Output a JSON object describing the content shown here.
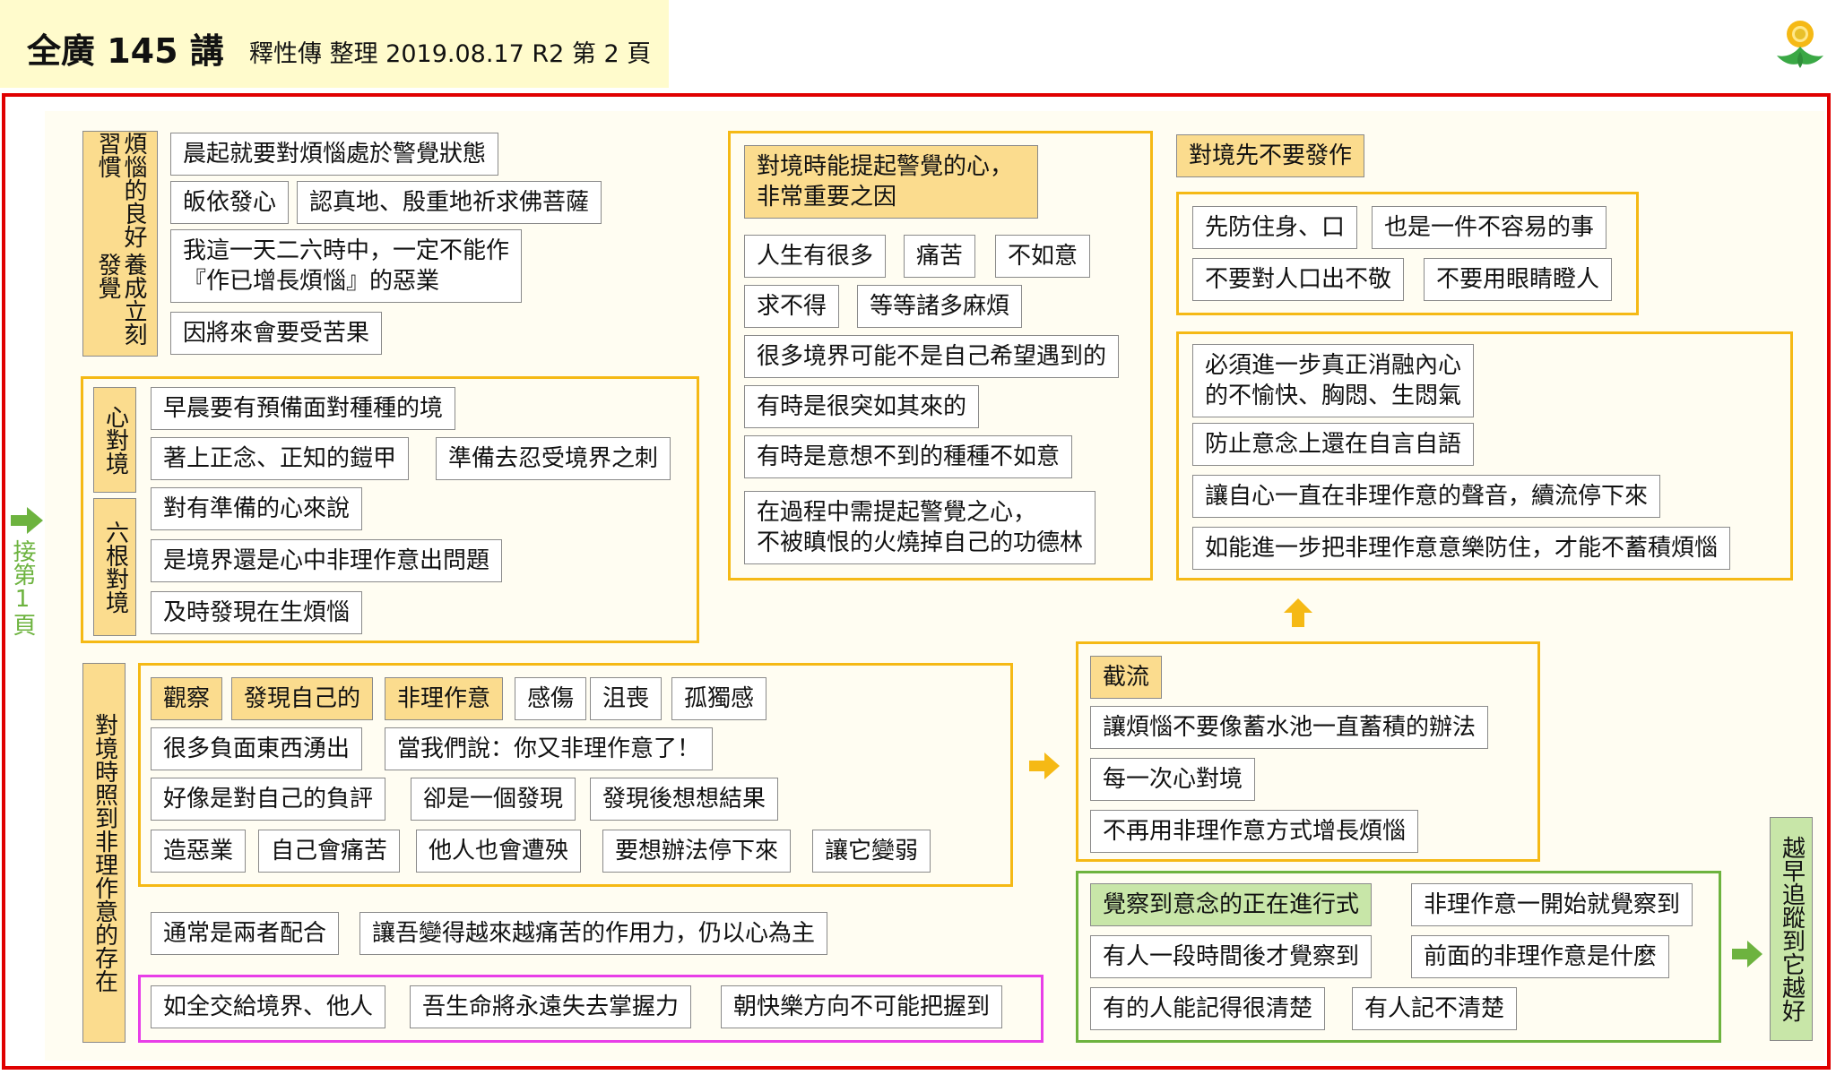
{
  "header": {
    "title": "全廣 145 講",
    "subtitle": "釋性傳 整理 2019.08.17 R2 第 2 頁"
  },
  "side": {
    "prev_page": "接第1頁"
  },
  "habit": {
    "label_a": "煩惱的良好習慣",
    "label_b": "養成立刻發覺",
    "items": [
      "晨起就要對煩惱處於警覺狀態",
      "皈依發心",
      "認真地、殷重地祈求佛菩薩",
      "我這一天二六時中，一定不能作",
      "『作已增長煩惱』的惡業",
      "因將來會要受苦果"
    ]
  },
  "mind": {
    "label1": "心對境",
    "label2": "六根對境",
    "items": [
      "早晨要有預備面對種種的境",
      "著上正念、正知的鎧甲",
      "準備去忍受境界之刺",
      "對有準備的心來說",
      "是境界還是心中非理作意出問題",
      "及時發現在生煩惱"
    ]
  },
  "observe": {
    "label": "對境時照到非理作意的存在",
    "items": [
      "觀察",
      "發現自己的",
      "非理作意",
      "感傷",
      "沮喪",
      "孤獨感",
      "很多負面東西湧出",
      "當我們說：你又非理作意了！",
      "好像是對自己的負評",
      "卻是一個發現",
      "發現後想想結果",
      "造惡業",
      "自己會痛苦",
      "他人也會遭殃",
      "要想辦法停下來",
      "讓它變弱"
    ],
    "extra": [
      "通常是兩者配合",
      "讓吾變得越來越痛苦的作用力，仍以心為主"
    ],
    "pink": [
      "如全交給境界、他人",
      "吾生命將永遠失去掌握力",
      "朝快樂方向不可能把握到"
    ]
  },
  "alert": {
    "title_1": "對境時能提起警覺的心，",
    "title_2": "非常重要之因",
    "items": [
      "人生有很多",
      "痛苦",
      "不如意",
      "求不得",
      "等等諸多麻煩",
      "很多境界可能不是自己希望遇到的",
      "有時是很突如其來的",
      "有時是意想不到的種種不如意",
      "在過程中需提起警覺之心，",
      "不被瞋恨的火燒掉自己的功德林"
    ]
  },
  "first": {
    "title": "對境先不要發作",
    "items": [
      "先防住身、口",
      "也是一件不容易的事",
      "不要對人口出不敬",
      "不要用眼睛瞪人"
    ]
  },
  "further": {
    "items": [
      "必須進一步真正消融內心",
      "的不愉快、胸悶、生悶氣",
      "防止意念上還在自言自語",
      "讓自心一直在非理作意的聲音，續流停下來",
      "如能進一步把非理作意意樂防住，才能不蓄積煩惱"
    ]
  },
  "cut": {
    "title": "截流",
    "items": [
      "讓煩惱不要像蓄水池一直蓄積的辦法",
      "每一次心對境",
      "不再用非理作意方式增長煩惱"
    ]
  },
  "aware": {
    "title": "覺察到意念的正在進行式",
    "items": [
      "非理作意一開始就覺察到",
      "有人一段時間後才覺察到",
      "前面的非理作意是什麼",
      "有的人能記得很清楚",
      "有人記不清楚"
    ]
  },
  "early": {
    "label": "越早追蹤到它越好"
  },
  "colors": {
    "frame": "#e00000",
    "yellow": "#f5b915",
    "green": "#6db33f",
    "pink": "#e83ee8",
    "label_fill": "#fbdc8e",
    "green_fill": "#c8e6a8"
  }
}
